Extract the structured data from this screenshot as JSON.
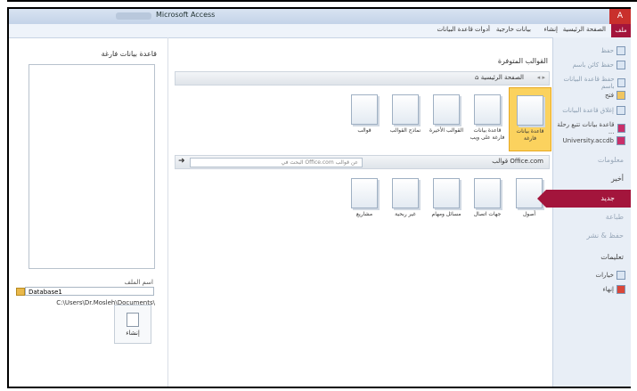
{
  "window": {
    "title": "Microsoft Access",
    "close_glyph": "A"
  },
  "ribbon": {
    "file_tab": "ملف",
    "tabs": [
      "الصفحة الرئيسية",
      "إنشاء",
      "بيانات خارجية",
      "أدوات قاعدة البيانات"
    ]
  },
  "sidebar": {
    "items_top": [
      {
        "label": "حفظ",
        "icon": "save-icon",
        "dim": true
      },
      {
        "label": "حفظ كائن باسم",
        "icon": "save-object-as-icon",
        "dim": true
      },
      {
        "label": "حفظ قاعدة البيانات باسم",
        "icon": "save-database-as-icon",
        "dim": true
      },
      {
        "label": "فتح",
        "icon": "open-folder-icon",
        "dim": false
      },
      {
        "label": "إغلاق قاعدة البيانات",
        "icon": "close-database-icon",
        "dim": true
      },
      {
        "label": "قاعدة بيانات تتبع رحلة ...",
        "icon": "database-icon",
        "dim": false
      },
      {
        "label": "University.accdb",
        "icon": "database-icon",
        "dim": false
      }
    ],
    "info": "معلومات",
    "recent": "أخير",
    "new": "جديد",
    "print": "طباعة",
    "save_publish": "حفظ & نشر",
    "help": "تعليمات",
    "options": "خيارات",
    "exit": "إنهاء"
  },
  "templates": {
    "section_title": "القوالب المتوفرة",
    "home": "الصفحة الرئيسية",
    "items": [
      {
        "label": "قاعدة بيانات فارغة",
        "selected": true
      },
      {
        "label": "قاعدة بيانات فارغة على ويب",
        "selected": false
      },
      {
        "label": "القوالب الأخيرة",
        "selected": false
      },
      {
        "label": "نماذج القوالب",
        "selected": false
      },
      {
        "label": "قوالب",
        "selected": false
      }
    ],
    "office_label": "قوالب Office.com",
    "search_placeholder": "البحث في Office.com عن قوالب",
    "office_items": [
      {
        "label": "أصول"
      },
      {
        "label": "جهات اتصال"
      },
      {
        "label": "مسائل ومهام"
      },
      {
        "label": "غير ربحية"
      },
      {
        "label": "مشاريع"
      }
    ]
  },
  "right_panel": {
    "title": "قاعدة بيانات فارغة",
    "file_name_label": "اسم الملف",
    "file_name": "Database1",
    "path": "C:\\Users\\Dr.Mosleh\\Documents\\",
    "create_label": "إنشاء"
  }
}
